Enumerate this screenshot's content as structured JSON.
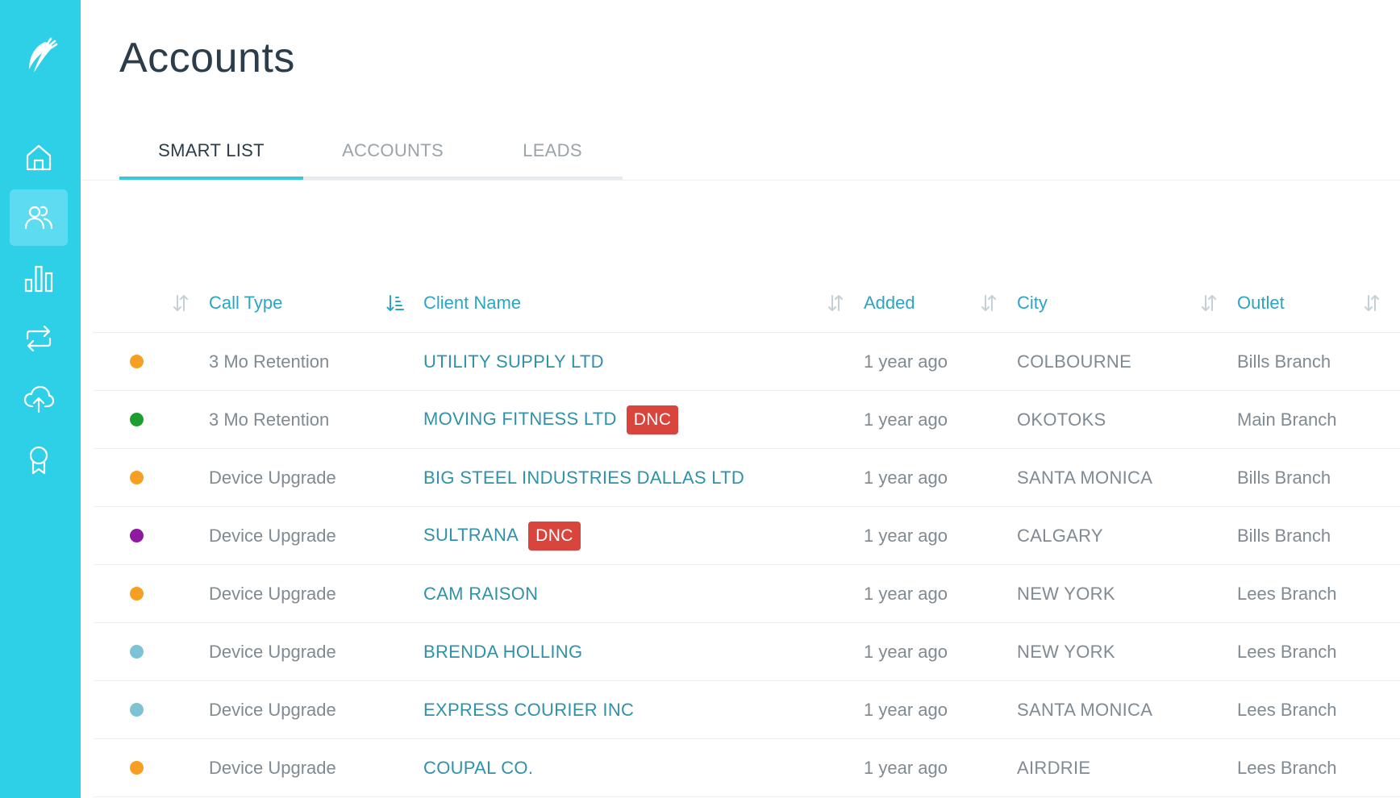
{
  "page": {
    "title": "Accounts"
  },
  "sidebar": {
    "logo_icon": "feather-logo-icon",
    "items": [
      {
        "name": "home",
        "icon": "home-icon",
        "active": false
      },
      {
        "name": "accounts",
        "icon": "users-icon",
        "active": true
      },
      {
        "name": "reports",
        "icon": "bar-chart-icon",
        "active": false
      },
      {
        "name": "sync",
        "icon": "repeat-icon",
        "active": false
      },
      {
        "name": "upload",
        "icon": "cloud-upload-icon",
        "active": false
      },
      {
        "name": "awards",
        "icon": "award-icon",
        "active": false
      }
    ]
  },
  "tabs": [
    {
      "label": "SMART LIST",
      "active": true
    },
    {
      "label": "ACCOUNTS",
      "active": false
    },
    {
      "label": "LEADS",
      "active": false
    }
  ],
  "table": {
    "columns": {
      "call_type": "Call Type",
      "client_name": "Client Name",
      "added": "Added",
      "city": "City",
      "outlet": "Outlet"
    },
    "rows": [
      {
        "status_color": "#f5a023",
        "call_type": "3 Mo Retention",
        "client_name": "UTILITY SUPPLY LTD",
        "badge": "",
        "added": "1 year ago",
        "city": "COLBOURNE",
        "outlet": "Bills Branch"
      },
      {
        "status_color": "#1e9e2e",
        "call_type": "3 Mo Retention",
        "client_name": "MOVING FITNESS LTD",
        "badge": "DNC",
        "added": "1 year ago",
        "city": "OKOTOKS",
        "outlet": "Main Branch"
      },
      {
        "status_color": "#f5a023",
        "call_type": "Device Upgrade",
        "client_name": "BIG STEEL INDUSTRIES DALLAS LTD",
        "badge": "",
        "added": "1 year ago",
        "city": "SANTA MONICA",
        "outlet": "Bills Branch"
      },
      {
        "status_color": "#8e1a9e",
        "call_type": "Device Upgrade",
        "client_name": "SULTRANA",
        "badge": "DNC",
        "added": "1 year ago",
        "city": "CALGARY",
        "outlet": "Bills Branch"
      },
      {
        "status_color": "#f5a023",
        "call_type": "Device Upgrade",
        "client_name": "CAM RAISON",
        "badge": "",
        "added": "1 year ago",
        "city": "NEW YORK",
        "outlet": "Lees Branch"
      },
      {
        "status_color": "#7dc3d3",
        "call_type": "Device Upgrade",
        "client_name": "BRENDA HOLLING",
        "badge": "",
        "added": "1 year ago",
        "city": "NEW YORK",
        "outlet": "Lees Branch"
      },
      {
        "status_color": "#7dc3d3",
        "call_type": "Device Upgrade",
        "client_name": "EXPRESS COURIER INC",
        "badge": "",
        "added": "1 year ago",
        "city": "SANTA MONICA",
        "outlet": "Lees Branch"
      },
      {
        "status_color": "#f5a023",
        "call_type": "Device Upgrade",
        "client_name": "COUPAL CO.",
        "badge": "",
        "added": "1 year ago",
        "city": "AIRDRIE",
        "outlet": "Lees Branch"
      }
    ]
  },
  "colors": {
    "sidebar_bg": "#2dd0e6",
    "accent": "#37c8e0",
    "link": "#2f92a8",
    "dnc_badge": "#d9443d"
  }
}
